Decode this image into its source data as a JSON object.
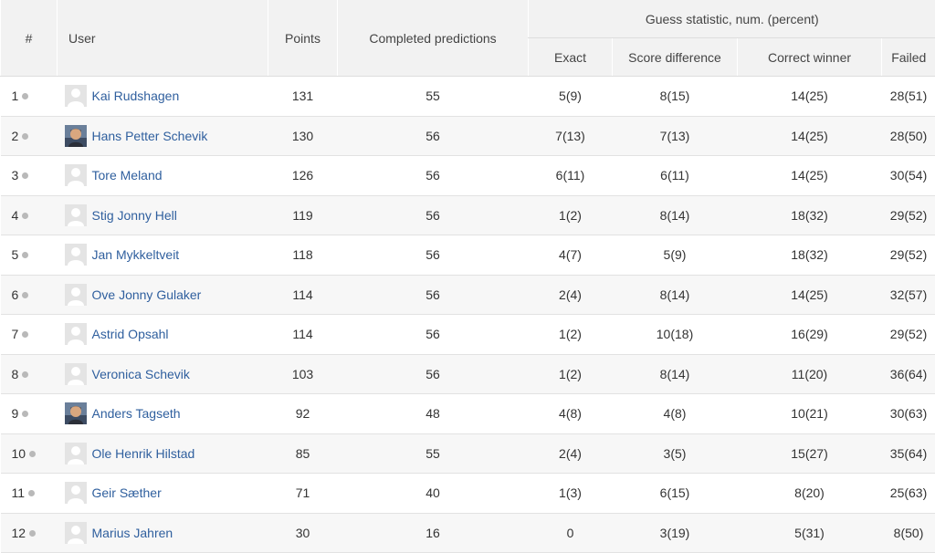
{
  "headers": {
    "rank": "#",
    "user": "User",
    "points": "Points",
    "completed": "Completed predictions",
    "group": "Guess statistic, num. (percent)",
    "exact": "Exact",
    "score_diff": "Score difference",
    "correct_winner": "Correct winner",
    "failed": "Failed"
  },
  "rows": [
    {
      "rank": "1",
      "name": "Kai Rudshagen",
      "avatar": "default-avatar",
      "points": "131",
      "completed": "55",
      "exact": "5(9)",
      "score_diff": "8(15)",
      "correct_winner": "14(25)",
      "failed": "28(51)"
    },
    {
      "rank": "2",
      "name": "Hans Petter Schevik",
      "avatar": "photo-avatar",
      "points": "130",
      "completed": "56",
      "exact": "7(13)",
      "score_diff": "7(13)",
      "correct_winner": "14(25)",
      "failed": "28(50)"
    },
    {
      "rank": "3",
      "name": "Tore Meland",
      "avatar": "default-avatar",
      "points": "126",
      "completed": "56",
      "exact": "6(11)",
      "score_diff": "6(11)",
      "correct_winner": "14(25)",
      "failed": "30(54)"
    },
    {
      "rank": "4",
      "name": "Stig Jonny Hell",
      "avatar": "default-avatar",
      "points": "119",
      "completed": "56",
      "exact": "1(2)",
      "score_diff": "8(14)",
      "correct_winner": "18(32)",
      "failed": "29(52)"
    },
    {
      "rank": "5",
      "name": "Jan Mykkeltveit",
      "avatar": "default-avatar",
      "points": "118",
      "completed": "56",
      "exact": "4(7)",
      "score_diff": "5(9)",
      "correct_winner": "18(32)",
      "failed": "29(52)"
    },
    {
      "rank": "6",
      "name": "Ove Jonny Gulaker",
      "avatar": "default-avatar",
      "points": "114",
      "completed": "56",
      "exact": "2(4)",
      "score_diff": "8(14)",
      "correct_winner": "14(25)",
      "failed": "32(57)"
    },
    {
      "rank": "7",
      "name": "Astrid Opsahl",
      "avatar": "default-avatar",
      "points": "114",
      "completed": "56",
      "exact": "1(2)",
      "score_diff": "10(18)",
      "correct_winner": "16(29)",
      "failed": "29(52)"
    },
    {
      "rank": "8",
      "name": "Veronica Schevik",
      "avatar": "default-avatar",
      "points": "103",
      "completed": "56",
      "exact": "1(2)",
      "score_diff": "8(14)",
      "correct_winner": "11(20)",
      "failed": "36(64)"
    },
    {
      "rank": "9",
      "name": "Anders Tagseth",
      "avatar": "photo-avatar",
      "points": "92",
      "completed": "48",
      "exact": "4(8)",
      "score_diff": "4(8)",
      "correct_winner": "10(21)",
      "failed": "30(63)"
    },
    {
      "rank": "10",
      "name": "Ole Henrik Hilstad",
      "avatar": "default-avatar",
      "points": "85",
      "completed": "55",
      "exact": "2(4)",
      "score_diff": "3(5)",
      "correct_winner": "15(27)",
      "failed": "35(64)"
    },
    {
      "rank": "11",
      "name": "Geir Sæther",
      "avatar": "default-avatar",
      "points": "71",
      "completed": "40",
      "exact": "1(3)",
      "score_diff": "6(15)",
      "correct_winner": "8(20)",
      "failed": "25(63)"
    },
    {
      "rank": "12",
      "name": "Marius Jahren",
      "avatar": "default-avatar",
      "points": "30",
      "completed": "16",
      "exact": "0",
      "score_diff": "3(19)",
      "correct_winner": "5(31)",
      "failed": "8(50)"
    }
  ],
  "colors": {
    "header_bg": "#f2f2f2",
    "link": "#2f5f9e",
    "stripe": "#f7f7f7",
    "dot": "#b9b9b9"
  }
}
